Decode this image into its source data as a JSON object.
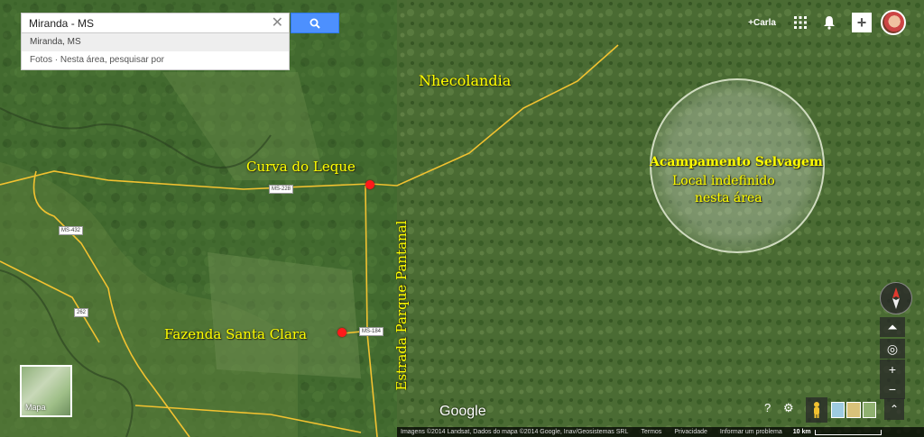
{
  "search": {
    "value": "Miranda - MS",
    "clear_label": "✕"
  },
  "suggestions": [
    {
      "label": "Miranda, MS"
    },
    {
      "label": "Fotos · Nesta área, pesquisar por"
    }
  ],
  "header": {
    "user_label": "+Carla",
    "share_label": "+"
  },
  "map_labels": {
    "nhecolandia": "Nhecolandia",
    "curva": "Curva do Leque",
    "fazenda": "Fazenda Santa Clara",
    "estrada": "Estrada Parque Pantanal",
    "acampamento": "Acampamento Selvagem",
    "local1": "Local indefinido",
    "local2": "nesta área"
  },
  "roads": {
    "ms228": "MS-228",
    "ms432": "MS-432",
    "r262": "262",
    "ms184": "MS-184"
  },
  "thumbnail": {
    "label": "Mapa"
  },
  "logo": "Google",
  "footer": {
    "attribution": "Imagens ©2014 Landsat, Dados do mapa ©2014 Google, Inav/Geosistemas SRL",
    "terms": "Termos",
    "privacy": "Privacidade",
    "report": "Informar um problema",
    "scale": "10 km"
  },
  "zoom": {
    "in": "+",
    "out": "−"
  },
  "colors": {
    "label": "#ffff00",
    "road": "#f2c230",
    "pin": "#ff1a1a",
    "search_button": "#4d90fe"
  }
}
